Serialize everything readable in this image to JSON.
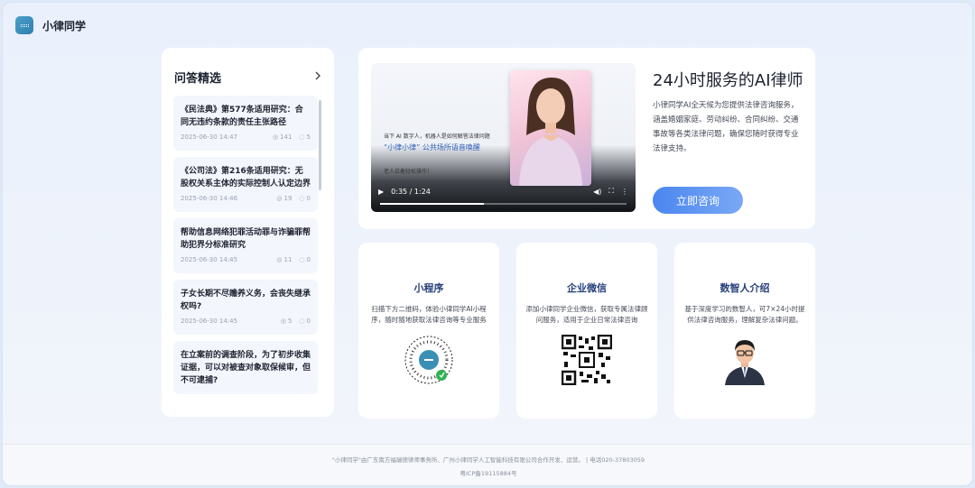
{
  "app": {
    "brand": "小律同学",
    "logo_icon": "chat-bubble-icon"
  },
  "qa": {
    "title": "问答精选",
    "more_icon": "chevron-right-icon",
    "items": [
      {
        "q": "《民法典》第577条适用研究：合同无违约条款的责任主张路径",
        "date": "2025-06-30 14:47",
        "views": "141",
        "comments": "5"
      },
      {
        "q": "《公司法》第216条适用研究：无股权关系主体的实际控制人认定边界",
        "date": "2025-06-30 14:46",
        "views": "19",
        "comments": "0"
      },
      {
        "q": "帮助信息网络犯罪活动罪与诈骗罪帮助犯界分标准研究",
        "date": "2025-06-30 14:45",
        "views": "11",
        "comments": "0"
      },
      {
        "q": "子女长期不尽赡养义务，会丧失继承权吗?",
        "date": "2025-06-30 14:45",
        "views": "5",
        "comments": "0"
      },
      {
        "q": "在立案前的调查阶段，为了初步收集证据，可以对被查对象取保候审，但不可逮捕?",
        "date": "",
        "views": "",
        "comments": ""
      }
    ]
  },
  "hero": {
    "video": {
      "line1": "当下 AI 数字人，机器人是如何解答法律问题",
      "line2": "“小律小律” 公共场所语音唤醒",
      "line3": "老人拉着轻松操作！",
      "time": "0:35 / 1:24",
      "progress": 0.42
    },
    "title": "24小时服务的AI律师",
    "description": "小律同学AI全天候为您提供法律咨询服务，涵盖婚姻家庭、劳动纠纷、合同纠纷、交通事故等各类法律问题，确保您随时获得专业法律支持。",
    "cta": "立即咨询"
  },
  "cards": [
    {
      "title": "小程序",
      "desc": "扫描下方二维码，体验小律同学AI小程序，随时随地获取法律咨询等专业服务",
      "icon": "mini-program-code-icon"
    },
    {
      "title": "企业微信",
      "desc": "添加小律同学企业微信，获取专属法律顾问服务，适用于企业日常法律咨询",
      "icon": "qr-code-icon"
    },
    {
      "title": "数智人介绍",
      "desc": "基于深度学习的数智人，可7×24小时提供法律咨询服务，理解复杂法律问题。",
      "icon": "digital-human-avatar-icon"
    }
  ],
  "footer": {
    "line1": "\"小律同学\"由广东南方福瑞德律师事务所、广州小律同学人工智能科技有限公司合作开发、运营。 | 电话020-37803059",
    "line2": "粤ICP备19115884号"
  }
}
